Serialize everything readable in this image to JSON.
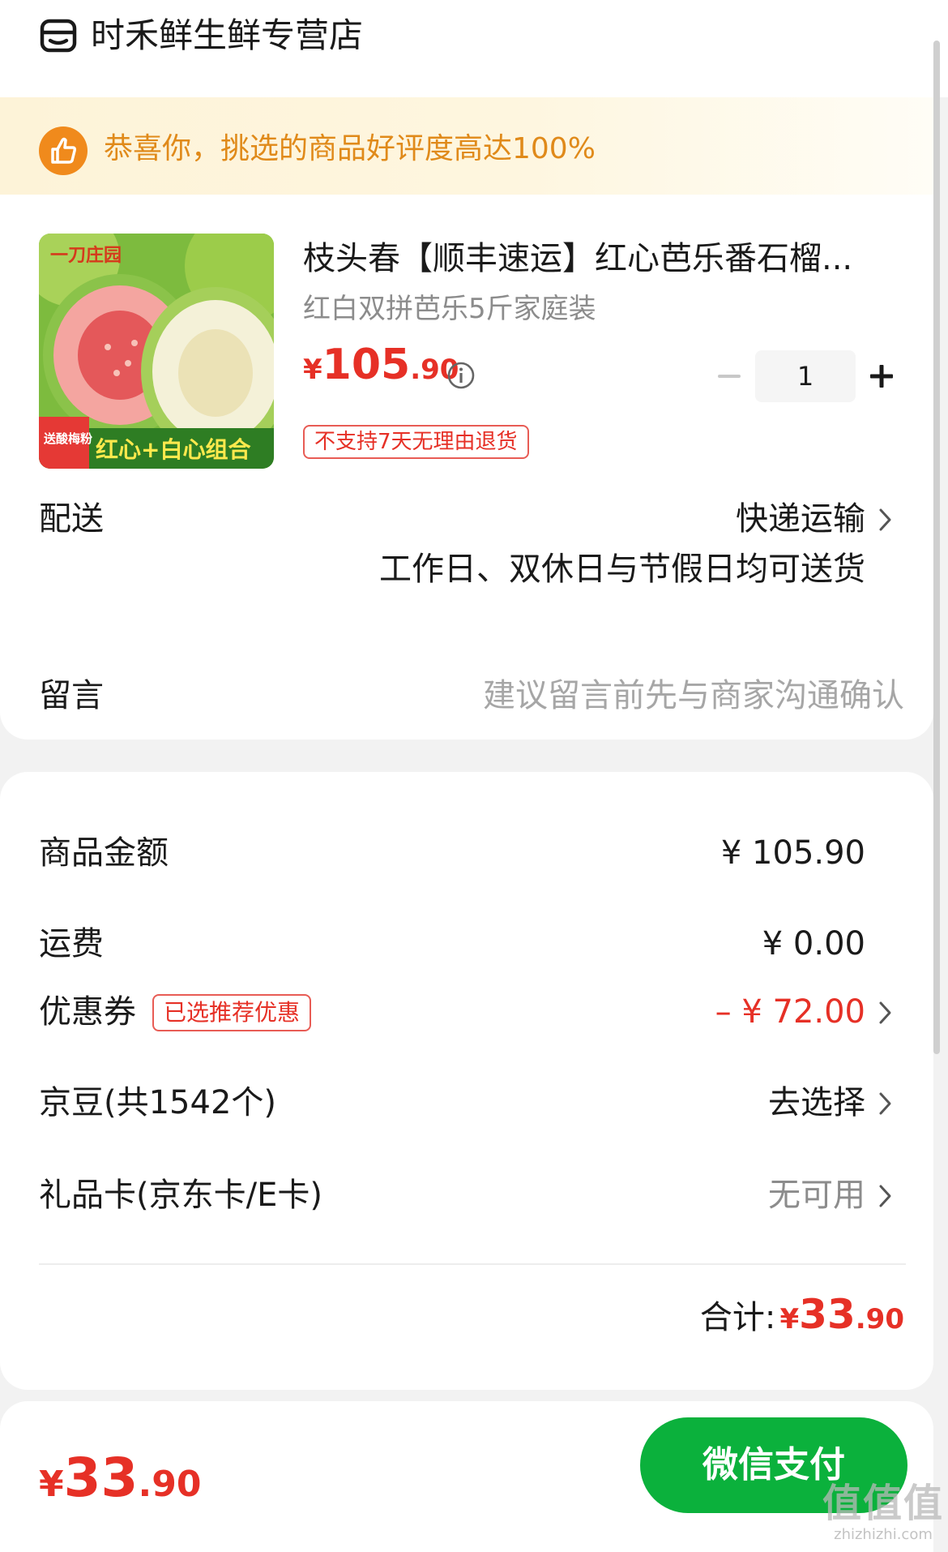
{
  "header": {
    "store_name": "时禾鲜生鲜专营店"
  },
  "banner": {
    "text": "恭喜你，挑选的商品好评度高达100%"
  },
  "product": {
    "image_brand": "一刀庄园",
    "image_tag_left": "送酸梅粉",
    "image_tag_main": "红心+白心组合",
    "title": "枝头春【顺丰速运】红心芭乐番石榴...",
    "spec": "红白双拼芭乐5斤家庭装",
    "price_yen": "¥",
    "price_int": "105",
    "price_dec": ".90",
    "quantity": "1",
    "return_tag": "不支持7天无理由退货"
  },
  "delivery": {
    "label": "配送",
    "method": "快递运输",
    "note": "工作日、双休日与节假日均可送货"
  },
  "message": {
    "label": "留言",
    "placeholder": "建议留言前先与商家沟通确认"
  },
  "summary": {
    "goods_label": "商品金额",
    "goods_value": "¥ 105.90",
    "shipping_label": "运费",
    "shipping_value": "¥ 0.00",
    "coupon_label": "优惠券",
    "coupon_tag": "已选推荐优惠",
    "coupon_value": "– ¥ 72.00",
    "jingdou_label": "京豆(共1542个)",
    "jingdou_value": "去选择",
    "giftcard_label": "礼品卡(京东卡/E卡)",
    "giftcard_value": "无可用",
    "total_label": "合计:",
    "total_yen": "¥",
    "total_int": "33",
    "total_dec": ".90"
  },
  "bottom": {
    "price_yen": "¥",
    "price_int": "33",
    "price_dec": ".90",
    "pay_button": "微信支付"
  },
  "watermark": {
    "big": "值值值",
    "small": "zhizhizhi.com"
  },
  "colors": {
    "accent_red": "#e63026",
    "pay_green": "#0bb13c",
    "banner_orange": "#e08a1a"
  }
}
